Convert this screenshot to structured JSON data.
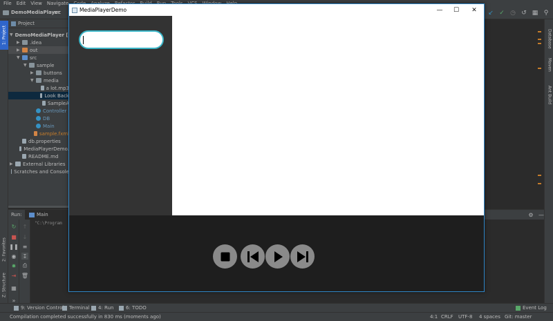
{
  "menu": [
    "File",
    "Edit",
    "View",
    "Navigate",
    "Code",
    "Analyze",
    "Refactor",
    "Build",
    "Run",
    "Tools",
    "VCS",
    "Window",
    "Help"
  ],
  "nav": {
    "project_name": "DemoMediaPlayer",
    "crumb": "src"
  },
  "left_tabs": {
    "project": "1: Project",
    "favorites": "2: Favorites",
    "structure": "Z: Structure"
  },
  "right_tabs": {
    "database": "Database",
    "maven": "Maven",
    "ant": "Ant Build"
  },
  "project_panel": {
    "title": "Project",
    "tree": [
      {
        "label": "DemoMediaPlayer [M",
        "icon": "folder",
        "depth": 0,
        "arrow": "open",
        "bold": true
      },
      {
        "label": ".idea",
        "icon": "folder",
        "depth": 1,
        "arrow": "closed"
      },
      {
        "label": "out",
        "icon": "orange",
        "depth": 1,
        "arrow": "closed",
        "selected_dim": true
      },
      {
        "label": "src",
        "icon": "blue",
        "depth": 1,
        "arrow": "open"
      },
      {
        "label": "sample",
        "icon": "folder",
        "depth": 2,
        "arrow": "open"
      },
      {
        "label": "buttons",
        "icon": "folder",
        "depth": 3,
        "arrow": "closed"
      },
      {
        "label": "media",
        "icon": "folder",
        "depth": 3,
        "arrow": "open"
      },
      {
        "label": "a lot.mp3",
        "icon": "file",
        "depth": 4,
        "arrow": ""
      },
      {
        "label": "Look Back",
        "icon": "file",
        "depth": 4,
        "arrow": "",
        "selected": true
      },
      {
        "label": "SampleA",
        "icon": "file",
        "depth": 4,
        "arrow": ""
      },
      {
        "label": "Controller",
        "icon": "java",
        "depth": 3,
        "arrow": ""
      },
      {
        "label": "DB",
        "icon": "java",
        "depth": 3,
        "arrow": ""
      },
      {
        "label": "Main",
        "icon": "java",
        "depth": 3,
        "arrow": ""
      },
      {
        "label": "sample.fxml",
        "icon": "orange",
        "depth": 3,
        "arrow": ""
      },
      {
        "label": "db.properties",
        "icon": "file",
        "depth": 1,
        "arrow": ""
      },
      {
        "label": "MediaPlayerDemo.",
        "icon": "file",
        "depth": 1,
        "arrow": ""
      },
      {
        "label": "README.md",
        "icon": "file",
        "depth": 1,
        "arrow": ""
      },
      {
        "label": "External Libraries",
        "icon": "lib",
        "depth": 0,
        "arrow": "closed"
      },
      {
        "label": "Scratches and Console",
        "icon": "lib",
        "depth": 0,
        "arrow": ""
      }
    ]
  },
  "run_panel": {
    "label": "Run:",
    "tab": "Main",
    "console": "\"C:\\Program"
  },
  "bottom_tabs": {
    "version_control": "9: Version Control",
    "terminal": "Terminal",
    "run": "4: Run",
    "todo": "6: TODO",
    "event_log": "Event Log"
  },
  "status": {
    "message": "Compilation completed successfully in 830 ms (moments ago)",
    "position": "4:1",
    "line_sep": "CRLF",
    "encoding": "UTF-8",
    "indent": "4 spaces",
    "git": "Git: master"
  },
  "media_player": {
    "title": "MediaPlayerDemo",
    "search_value": "",
    "search_accent": "#3bb6c8",
    "controls": [
      "stop-icon",
      "previous-icon",
      "play-icon",
      "next-icon"
    ]
  }
}
